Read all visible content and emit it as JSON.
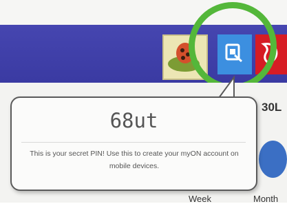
{
  "colors": {
    "navbar": "#4040aa",
    "pin_button": "#3c8fe0",
    "highlight_ring": "#54b73a",
    "red_tab": "#d61c24"
  },
  "icons": {
    "pin_button": "tablet-icon",
    "red_tab": "tag-icon",
    "calendar": "calendar-icon"
  },
  "column_header": "30L",
  "tooltip": {
    "pin": "68ut",
    "message": "This is your secret PIN! Use this to create your myON account on mobile devices."
  },
  "view_labels": {
    "week": "Week",
    "month": "Month"
  }
}
